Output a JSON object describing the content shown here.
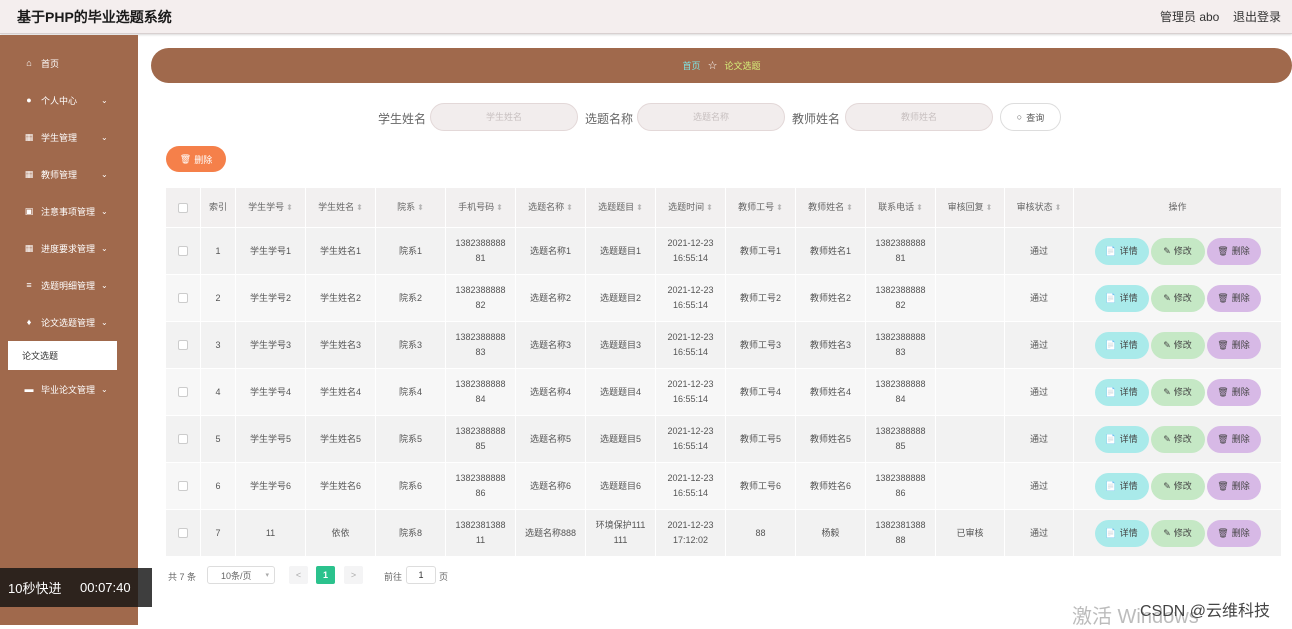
{
  "header": {
    "title": "基于PHP的毕业选题系统",
    "admin": "管理员 abo",
    "logout": "退出登录"
  },
  "sidebar": {
    "items": [
      {
        "icon": "home-icon",
        "label": "首页",
        "chevron": false
      },
      {
        "icon": "user-icon",
        "label": "个人中心",
        "chevron": true
      },
      {
        "icon": "grid-icon",
        "label": "学生管理",
        "chevron": true
      },
      {
        "icon": "grid-icon",
        "label": "教师管理",
        "chevron": true
      },
      {
        "icon": "calendar-icon",
        "label": "注意事项管理",
        "chevron": true
      },
      {
        "icon": "grid-icon",
        "label": "进度要求管理",
        "chevron": true
      },
      {
        "icon": "stack-icon",
        "label": "选题明细管理",
        "chevron": true
      },
      {
        "icon": "trophy-icon",
        "label": "论文选题管理",
        "chevron": true
      },
      {
        "icon": "monitor-icon",
        "label": "毕业论文管理",
        "chevron": true
      }
    ],
    "submenu_active": "论文选题"
  },
  "video_overlay": {
    "speed": "10秒快进",
    "time": "00:07:40"
  },
  "breadcrumb": {
    "home": "首页",
    "current": "论文选题"
  },
  "search": {
    "student_label": "学生姓名",
    "student_placeholder": "学生姓名",
    "topic_label": "选题名称",
    "topic_placeholder": "选题名称",
    "teacher_label": "教师姓名",
    "teacher_placeholder": "教师姓名",
    "button": "查询"
  },
  "delete_button": "删除",
  "table": {
    "columns": [
      "索引",
      "学生学号",
      "学生姓名",
      "院系",
      "手机号码",
      "选题名称",
      "选题题目",
      "选题时间",
      "教师工号",
      "教师姓名",
      "联系电话",
      "审核回复",
      "审核状态",
      "操作"
    ],
    "rows": [
      {
        "idx": "1",
        "sno": "学生学号1",
        "sname": "学生姓名1",
        "dept": "院系1",
        "phone": [
          "1382388888",
          "81"
        ],
        "topic": "选题名称1",
        "title": "选题题目1",
        "time": [
          "2021-12-23",
          "16:55:14"
        ],
        "tno": "教师工号1",
        "tname": "教师姓名1",
        "tel": [
          "1382388888",
          "81"
        ],
        "reply": "",
        "status": "通过"
      },
      {
        "idx": "2",
        "sno": "学生学号2",
        "sname": "学生姓名2",
        "dept": "院系2",
        "phone": [
          "1382388888",
          "82"
        ],
        "topic": "选题名称2",
        "title": "选题题目2",
        "time": [
          "2021-12-23",
          "16:55:14"
        ],
        "tno": "教师工号2",
        "tname": "教师姓名2",
        "tel": [
          "1382388888",
          "82"
        ],
        "reply": "",
        "status": "通过"
      },
      {
        "idx": "3",
        "sno": "学生学号3",
        "sname": "学生姓名3",
        "dept": "院系3",
        "phone": [
          "1382388888",
          "83"
        ],
        "topic": "选题名称3",
        "title": "选题题目3",
        "time": [
          "2021-12-23",
          "16:55:14"
        ],
        "tno": "教师工号3",
        "tname": "教师姓名3",
        "tel": [
          "1382388888",
          "83"
        ],
        "reply": "",
        "status": "通过"
      },
      {
        "idx": "4",
        "sno": "学生学号4",
        "sname": "学生姓名4",
        "dept": "院系4",
        "phone": [
          "1382388888",
          "84"
        ],
        "topic": "选题名称4",
        "title": "选题题目4",
        "time": [
          "2021-12-23",
          "16:55:14"
        ],
        "tno": "教师工号4",
        "tname": "教师姓名4",
        "tel": [
          "1382388888",
          "84"
        ],
        "reply": "",
        "status": "通过"
      },
      {
        "idx": "5",
        "sno": "学生学号5",
        "sname": "学生姓名5",
        "dept": "院系5",
        "phone": [
          "1382388888",
          "85"
        ],
        "topic": "选题名称5",
        "title": "选题题目5",
        "time": [
          "2021-12-23",
          "16:55:14"
        ],
        "tno": "教师工号5",
        "tname": "教师姓名5",
        "tel": [
          "1382388888",
          "85"
        ],
        "reply": "",
        "status": "通过"
      },
      {
        "idx": "6",
        "sno": "学生学号6",
        "sname": "学生姓名6",
        "dept": "院系6",
        "phone": [
          "1382388888",
          "86"
        ],
        "topic": "选题名称6",
        "title": "选题题目6",
        "time": [
          "2021-12-23",
          "16:55:14"
        ],
        "tno": "教师工号6",
        "tname": "教师姓名6",
        "tel": [
          "1382388888",
          "86"
        ],
        "reply": "",
        "status": "通过"
      },
      {
        "idx": "7",
        "sno": "11",
        "sname": "依依",
        "dept": "院系8",
        "phone": [
          "1382381388",
          "11"
        ],
        "topic": "选题名称888",
        "title": [
          "环境保护111",
          "111"
        ],
        "time": [
          "2021-12-23",
          "17:12:02"
        ],
        "tno": "88",
        "tname": "杨毅",
        "tel": [
          "1382381388",
          "88"
        ],
        "reply": "已审核",
        "status": "通过"
      }
    ],
    "actions": {
      "detail": "详情",
      "edit": "修改",
      "delete": "删除"
    }
  },
  "pagination": {
    "total": "共 7 条",
    "page_size": "10条/页",
    "prev": "<",
    "current": "1",
    "next": ">",
    "goto": "前往",
    "goto_value": "1",
    "page_suffix": "页"
  },
  "watermark": "激活 Windows",
  "csdn": "CSDN @云维科技"
}
